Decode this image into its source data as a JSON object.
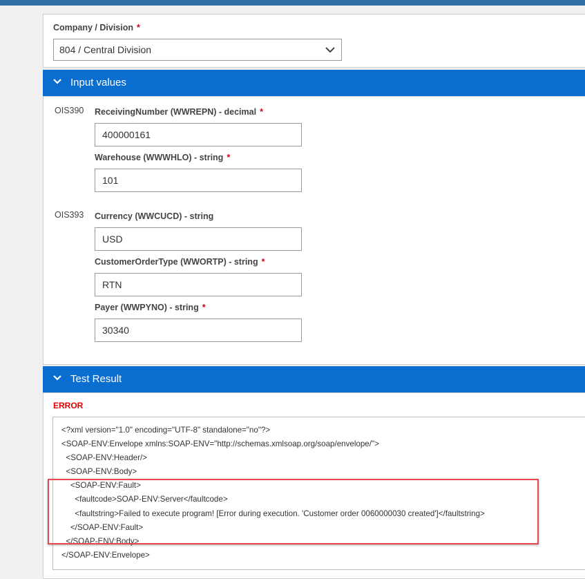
{
  "company": {
    "label": "Company / Division",
    "required_mark": "*",
    "value": "804 / Central Division"
  },
  "input_values": {
    "title": "Input values",
    "groups": [
      {
        "program": "OIS390",
        "fields": [
          {
            "label": "ReceivingNumber (WWREPN) - decimal",
            "required": "*",
            "value": "400000161"
          },
          {
            "label": "Warehouse (WWWHLO) - string",
            "required": "*",
            "value": "101"
          }
        ]
      },
      {
        "program": "OIS393",
        "fields": [
          {
            "label": "Currency (WWCUCD) - string",
            "required": "",
            "value": "USD"
          },
          {
            "label": "CustomerOrderType (WWORTP) - string",
            "required": "*",
            "value": "RTN"
          },
          {
            "label": "Payer (WWPYNO) - string",
            "required": "*",
            "value": "30340"
          }
        ]
      }
    ]
  },
  "test_result": {
    "title": "Test Result",
    "status": "ERROR",
    "xml_lines": [
      "<?xml version=\"1.0\" encoding=\"UTF-8\" standalone=\"no\"?>",
      "<SOAP-ENV:Envelope xmlns:SOAP-ENV=\"http://schemas.xmlsoap.org/soap/envelope/\">",
      "  <SOAP-ENV:Header/>",
      "  <SOAP-ENV:Body>",
      "    <SOAP-ENV:Fault>",
      "      <faultcode>SOAP-ENV:Server</faultcode>",
      "      <faultstring>Failed to execute program! [Error during execution. 'Customer order 0060000030 created']</faultstring>",
      "    </SOAP-ENV:Fault>",
      "  </SOAP-ENV:Body>",
      "</SOAP-ENV:Envelope>"
    ]
  },
  "colors": {
    "section_header": "#0a6ed1",
    "required": "#d0021b",
    "error": "#e00000",
    "highlight": "#e8474e"
  }
}
